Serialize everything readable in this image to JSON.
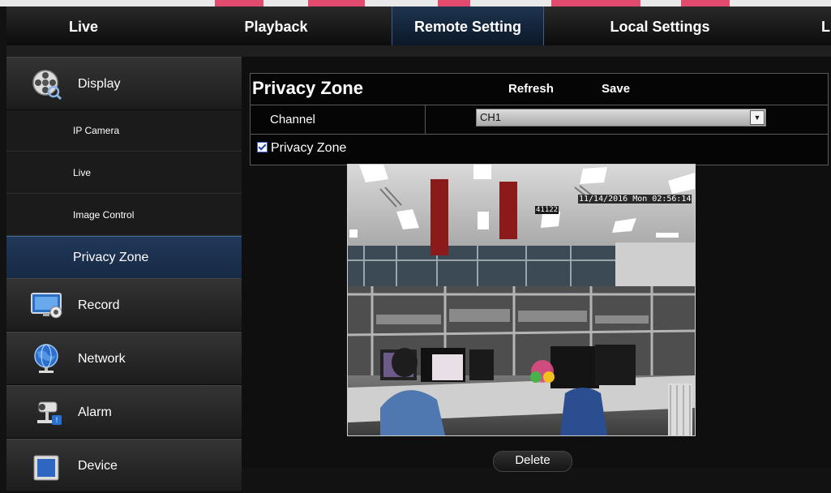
{
  "tabs": [
    {
      "label": "Live"
    },
    {
      "label": "Playback"
    },
    {
      "label": "Remote Setting",
      "active": true
    },
    {
      "label": "Local Settings"
    },
    {
      "label": "L"
    }
  ],
  "sidebar": {
    "display": {
      "label": "Display",
      "icon": "film-reel-icon"
    },
    "subitems": [
      {
        "label": "IP Camera"
      },
      {
        "label": "Live"
      },
      {
        "label": "Image Control"
      },
      {
        "label": "Privacy Zone",
        "active": true
      }
    ],
    "record": {
      "label": "Record",
      "icon": "monitor-record-icon"
    },
    "network": {
      "label": "Network",
      "icon": "globe-icon"
    },
    "alarm": {
      "label": "Alarm",
      "icon": "alarm-camera-icon"
    },
    "device": {
      "label": "Device",
      "icon": "device-icon"
    }
  },
  "form": {
    "title": "Privacy Zone",
    "refresh_label": "Refresh",
    "save_label": "Save",
    "channel_label": "Channel",
    "channel_value": "CH1",
    "privacy_zone_label": "Privacy Zone",
    "privacy_zone_checked": true
  },
  "video": {
    "timestamp": "11/14/2016 Mon 02:56:14",
    "camera_id": "41122",
    "zone_color": "#8b1b1b"
  },
  "delete_label": "Delete",
  "colors": {
    "active_tab": "#1d3450",
    "active_sidebar": "#21385a",
    "accent_top": "#e24a6e"
  }
}
